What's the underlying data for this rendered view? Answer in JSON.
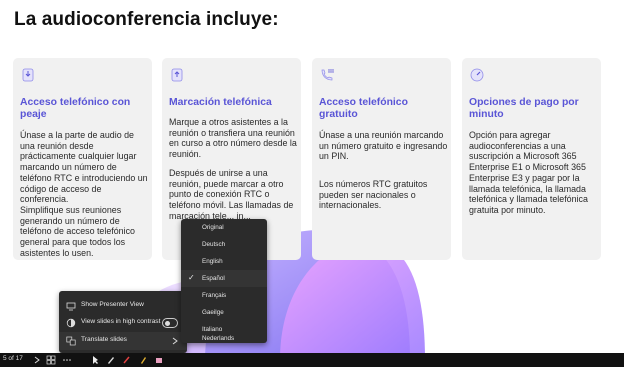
{
  "slide": {
    "title": "La audioconferencia incluye:"
  },
  "cards": [
    {
      "icon": "phone-download-icon",
      "title": "Acceso telefónico con peaje",
      "paragraphs": [
        "Únase a la parte de audio de una reunión desde prácticamente cualquier lugar marcando un número de teléfono RTC e introduciendo un código de acceso de conferencia.",
        "Simplifique sus reuniones generando un número de teléfono de acceso telefónico general para que todos los asistentes lo usen."
      ]
    },
    {
      "icon": "phone-upload-icon",
      "title": "Marcación telefónica",
      "paragraphs": [
        "Marque a otros asistentes a la reunión o transfiera una reunión en curso a otro número desde la reunión.",
        "Después de unirse a una reunión, puede marcar a otro punto de conexión RTC o teléfono móvil. Las llamadas de marcación tele... in..."
      ]
    },
    {
      "icon": "phone-dialpad-icon",
      "title": "Acceso telefónico gratuito",
      "paragraphs": [
        "Únase a una reunión marcando un número gratuito e ingresando un PIN.",
        "Los números RTC gratuitos pueden ser nacionales o internacionales."
      ]
    },
    {
      "icon": "payment-gauge-icon",
      "title": "Opciones de pago por minuto",
      "paragraphs": [
        "Opción para agregar audioconferencias a una suscripción a Microsoft 365 Enterprise E1 o Microsoft 365 Enterprise E3 y pagar por la llamada telefónica, la llamada telefónica y llamada telefónica gratuita por minuto."
      ]
    }
  ],
  "presenter_menu": {
    "items": [
      {
        "label": "Show Presenter View",
        "icon": "presenter-view-icon"
      },
      {
        "label": "View slides in high contrast",
        "icon": "contrast-icon",
        "toggle": false
      },
      {
        "label": "Translate slides",
        "icon": "translate-icon"
      }
    ]
  },
  "language_menu": {
    "items": [
      "Original",
      "Deutsch",
      "English",
      "Español",
      "Français",
      "Gaeilge",
      "Italiano",
      "Nederlands"
    ],
    "selected": "Español"
  },
  "bottom_bar": {
    "page_indicator": "5 of 17"
  },
  "colors": {
    "accent": "#5a55d6",
    "card_bg": "#f1f1f1",
    "menu_bg": "#2b2b2b",
    "bar_bg": "#111111"
  }
}
